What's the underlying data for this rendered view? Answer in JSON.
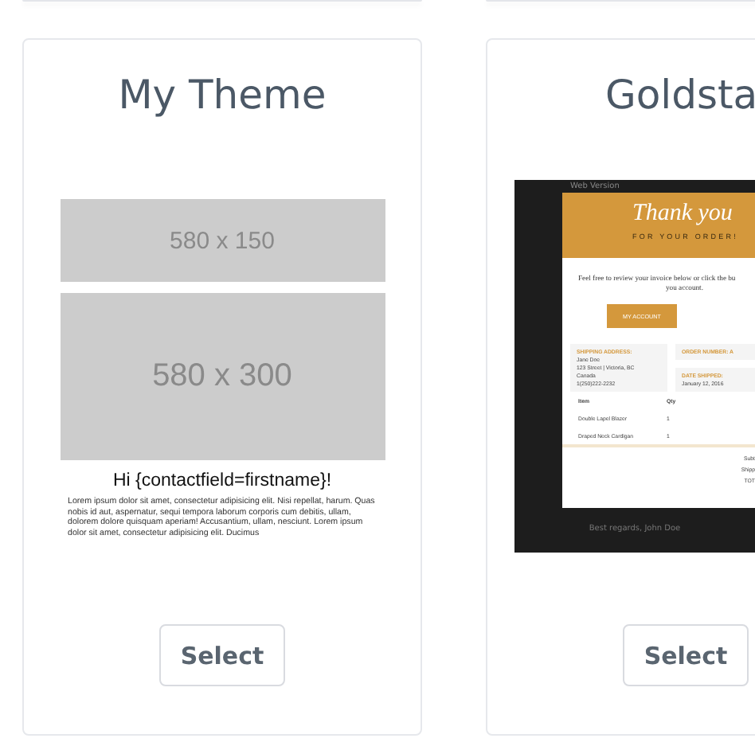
{
  "themes": [
    {
      "kind": "placeholder",
      "title": "My Theme",
      "button": "Select",
      "preview": {
        "banners": [
          {
            "label": "580 x 150",
            "kind": "small"
          },
          {
            "label": "580 x 300",
            "kind": "large"
          }
        ],
        "heading": "Hi {contactfield=firstname}!",
        "body": "Lorem ipsum dolor sit amet, consectetur adipisicing elit. Nisi repellat, harum. Quas nobis id aut, aspernatur, sequi tempora laborum corporis cum debitis, ullam, dolorem dolore quisquam aperiam! Accusantium, ullam, nesciunt. Lorem ipsum dolor sit amet, consectetur adipisicing elit. Ducimus"
      }
    },
    {
      "kind": "email",
      "title": "Goldsta",
      "button": "Select",
      "preview": {
        "top_bar": "Web Version",
        "thank": "Thank you",
        "subtitle": "FOR YOUR ORDER!",
        "intro": [
          "Feel free to review your invoice below or click the bu",
          "you account."
        ],
        "account_button": "MY ACCOUNT",
        "shipping_label": "SHIPPING ADDRESS:",
        "address": [
          "Jane Doe",
          "123 Street | Victoria, BC",
          "Canada",
          "1(250)222-2232"
        ],
        "order_label": "ORDER NUMBER: A",
        "date_label": "DATE SHIPPED:",
        "date": "January 12, 2016",
        "columns": [
          "Item",
          "Qty"
        ],
        "rows": [
          [
            "Double Lapel Blazer",
            "1"
          ],
          [
            "Draped Neck Cardigan",
            "1"
          ]
        ],
        "totals": [
          "Subt",
          "Shipp",
          "TOT"
        ],
        "footer": "Best regards, John Doe"
      }
    }
  ]
}
